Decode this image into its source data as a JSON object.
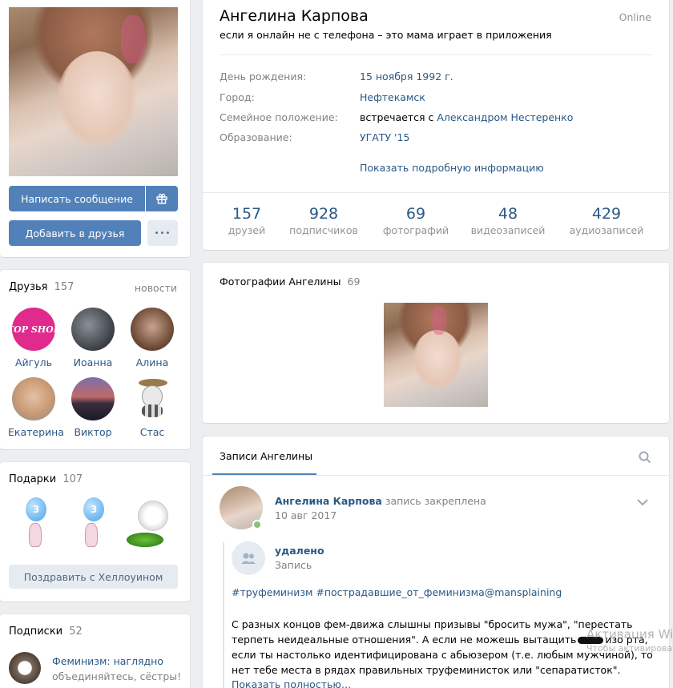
{
  "left": {
    "send_message": "Написать сообщение",
    "add_friend": "Добавить в друзья",
    "more": "•••",
    "friends": {
      "title": "Друзья",
      "count": "157",
      "news": "новости",
      "items": [
        {
          "name": "Айгуль",
          "avatar_text": "TOP SHOP"
        },
        {
          "name": "Иоанна"
        },
        {
          "name": "Алина"
        },
        {
          "name": "Екатерина"
        },
        {
          "name": "Виктор"
        },
        {
          "name": "Стас"
        }
      ]
    },
    "gifts": {
      "title": "Подарки",
      "count": "107",
      "button": "Поздравить с Хеллоуином",
      "balloon_digit": "3"
    },
    "subscriptions": {
      "title": "Подписки",
      "count": "52",
      "item_title": "Феминизм: наглядно",
      "item_sub": "объединяйтесь, сёстры!"
    }
  },
  "profile": {
    "name": "Ангелина Карпова",
    "online": "Online",
    "status": "если я онлайн не с телефона – это мама играет в приложения",
    "info": [
      {
        "label": "День рождения:",
        "value": "15 ноября 1992 г."
      },
      {
        "label": "Город:",
        "value": "Нефтекамск"
      },
      {
        "label": "Семейное положение:",
        "value_prefix": "встречается с ",
        "value": "Александром Нестеренко"
      },
      {
        "label": "Образование:",
        "value": "УГАТУ '15"
      }
    ],
    "more_info": "Показать подробную информацию",
    "stats": [
      {
        "num": "157",
        "label": "друзей"
      },
      {
        "num": "928",
        "label": "подписчиков"
      },
      {
        "num": "69",
        "label": "фотографий"
      },
      {
        "num": "48",
        "label": "видеозаписей"
      },
      {
        "num": "429",
        "label": "аудиозаписей"
      }
    ]
  },
  "photos": {
    "title": "Фотографии Ангелины",
    "count": "69"
  },
  "wall": {
    "tab": "Записи Ангелины",
    "post": {
      "author": "Ангелина Карпова",
      "action": "запись закреплена",
      "date": "10 авг 2017",
      "repost_author": "удалено",
      "repost_sub": "Запись",
      "hashtags": "#труфеминизм #пострадавшие_от_феминизма@mansplaining",
      "text_lines": [
        "С разных концов фем-движа слышны призывы \"бросить мужа\", \"перестать",
        "терпеть неидеальные отношения\". А если не можешь вытащить",
        "изо рта,",
        "если ты настолько идентифицирована с абьюзером (т.е. любым мужчиной), то",
        "нет тебе места в рядах правильных труфеминисток или \"сепаратисток\"."
      ],
      "show_more": "Показать полностью…"
    }
  },
  "watermark": {
    "line1": "Активация Windows",
    "line2": "Чтобы активировать Windows"
  }
}
